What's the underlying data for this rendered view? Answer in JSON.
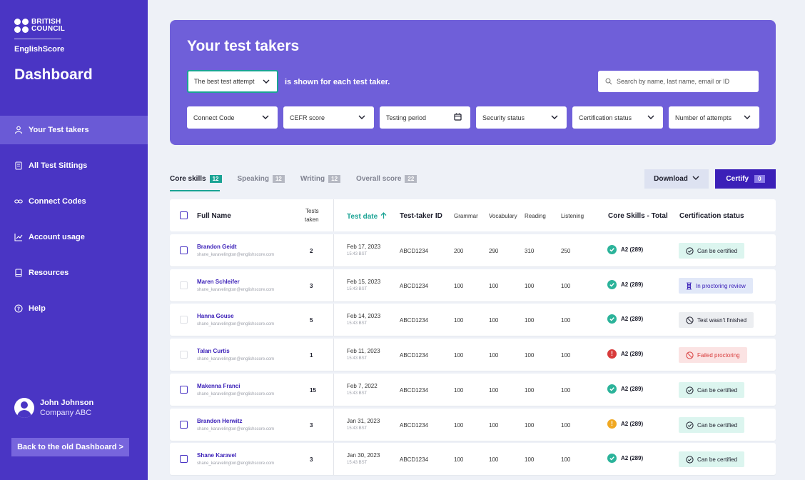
{
  "sidebar": {
    "brand_line1": "BRITISH",
    "brand_line2": "COUNCIL",
    "product": "EnglishScore",
    "title": "Dashboard",
    "items": [
      {
        "label": "Your Test takers",
        "icon": "users-icon",
        "active": true
      },
      {
        "label": "All Test Sittings",
        "icon": "document-icon",
        "active": false
      },
      {
        "label": "Connect Codes",
        "icon": "link-icon",
        "active": false
      },
      {
        "label": "Account usage",
        "icon": "chart-icon",
        "active": false
      },
      {
        "label": "Resources",
        "icon": "book-icon",
        "active": false
      },
      {
        "label": "Help",
        "icon": "help-icon",
        "active": false
      }
    ],
    "user_name": "John Johnson",
    "user_company": "Company ABC",
    "old_dashboard": "Back to the old Dashboard  >"
  },
  "hero": {
    "title": "Your test takers",
    "attempt_select": "The best test attempt",
    "shown_text": "is shown for each test taker.",
    "search_placeholder": "Search by name, last name, email or ID",
    "filters": [
      "Connect Code",
      "CEFR score",
      "Testing period",
      "Security status",
      "Certification status",
      "Number of attempts"
    ]
  },
  "tabs": [
    {
      "label": "Core skills",
      "count": "12"
    },
    {
      "label": "Speaking",
      "count": "12"
    },
    {
      "label": "Writing",
      "count": "12"
    },
    {
      "label": "Overall score",
      "count": "22"
    }
  ],
  "actions": {
    "download": "Download",
    "certify": "Certify",
    "certify_count": "0"
  },
  "table": {
    "headers": {
      "full_name": "Full Name",
      "tests": "Tests",
      "taken": "taken",
      "test_date": "Test date",
      "taker_id": "Test-taker ID",
      "grammar": "Grammar",
      "vocabulary": "Vocabulary",
      "reading": "Reading",
      "listening": "Listening",
      "core_total": "Core Skills - Total",
      "cert_status": "Certification status"
    },
    "rows": [
      {
        "name": "Brandon Geidt",
        "email": "shane_karavelington@englishscore.com",
        "taken": "2",
        "date": "Feb 17, 2023",
        "time": "15:43 BST",
        "id": "ABCD1234",
        "grammar": "200",
        "vocabulary": "290",
        "reading": "310",
        "listening": "250",
        "skill": "A2 (289)",
        "skill_status": "ok",
        "status": "Can be certified",
        "status_type": "certified",
        "enabled": true
      },
      {
        "name": "Maren Schleifer",
        "email": "shane_karavelington@englishscore.com",
        "taken": "3",
        "date": "Feb 15, 2023",
        "time": "15:43 BST",
        "id": "ABCD1234",
        "grammar": "100",
        "vocabulary": "100",
        "reading": "100",
        "listening": "100",
        "skill": "A2 (289)",
        "skill_status": "ok",
        "status": "In proctoring review",
        "status_type": "review",
        "enabled": false
      },
      {
        "name": "Hanna Gouse",
        "email": "shane_karavelington@englishscore.com",
        "taken": "5",
        "date": "Feb 14, 2023",
        "time": "15:43 BST",
        "id": "ABCD1234",
        "grammar": "100",
        "vocabulary": "100",
        "reading": "100",
        "listening": "100",
        "skill": "A2 (289)",
        "skill_status": "ok",
        "status": "Test wasn't finished",
        "status_type": "unfinished",
        "enabled": false
      },
      {
        "name": "Talan Curtis",
        "email": "shane_karavelington@englishscore.com",
        "taken": "1",
        "date": "Feb 11, 2023",
        "time": "15:43 BST",
        "id": "ABCD1234",
        "grammar": "100",
        "vocabulary": "100",
        "reading": "100",
        "listening": "100",
        "skill": "A2 (289)",
        "skill_status": "error",
        "status": "Failed proctoring",
        "status_type": "failed",
        "enabled": false
      },
      {
        "name": "Makenna Franci",
        "email": "shane_karavelington@englishscore.com",
        "taken": "15",
        "date": "Feb 7, 2022",
        "time": "15:43 BST",
        "id": "ABCD1234",
        "grammar": "100",
        "vocabulary": "100",
        "reading": "100",
        "listening": "100",
        "skill": "A2 (289)",
        "skill_status": "ok",
        "status": "Can be certified",
        "status_type": "certified",
        "enabled": true
      },
      {
        "name": "Brandon Herwitz",
        "email": "shane_karavelington@englishscore.com",
        "taken": "3",
        "date": "Jan 31, 2023",
        "time": "15:43 BST",
        "id": "ABCD1234",
        "grammar": "100",
        "vocabulary": "100",
        "reading": "100",
        "listening": "100",
        "skill": "A2 (289)",
        "skill_status": "warning",
        "status": "Can be certified",
        "status_type": "certified",
        "enabled": true
      },
      {
        "name": "Shane Karavel",
        "email": "shane_karavelington@englishscore.com",
        "taken": "3",
        "date": "Jan 30, 2023",
        "time": "15:43 BST",
        "id": "ABCD1234",
        "grammar": "100",
        "vocabulary": "100",
        "reading": "100",
        "listening": "100",
        "skill": "A2 (289)",
        "skill_status": "ok",
        "status": "Can be certified",
        "status_type": "certified",
        "enabled": true
      }
    ]
  },
  "colors": {
    "sidebar": "#4a35c4",
    "hero": "#6f5fd9",
    "accent": "#1aa394",
    "primary": "#3b20b8",
    "ok": "#2bb39a",
    "error": "#d83b3b",
    "warning": "#f0a822",
    "certified_bg": "#dcf5ef",
    "review_bg": "#e1e8f8",
    "unfinished_bg": "#eceef1",
    "failed_bg": "#fbe3e3"
  }
}
